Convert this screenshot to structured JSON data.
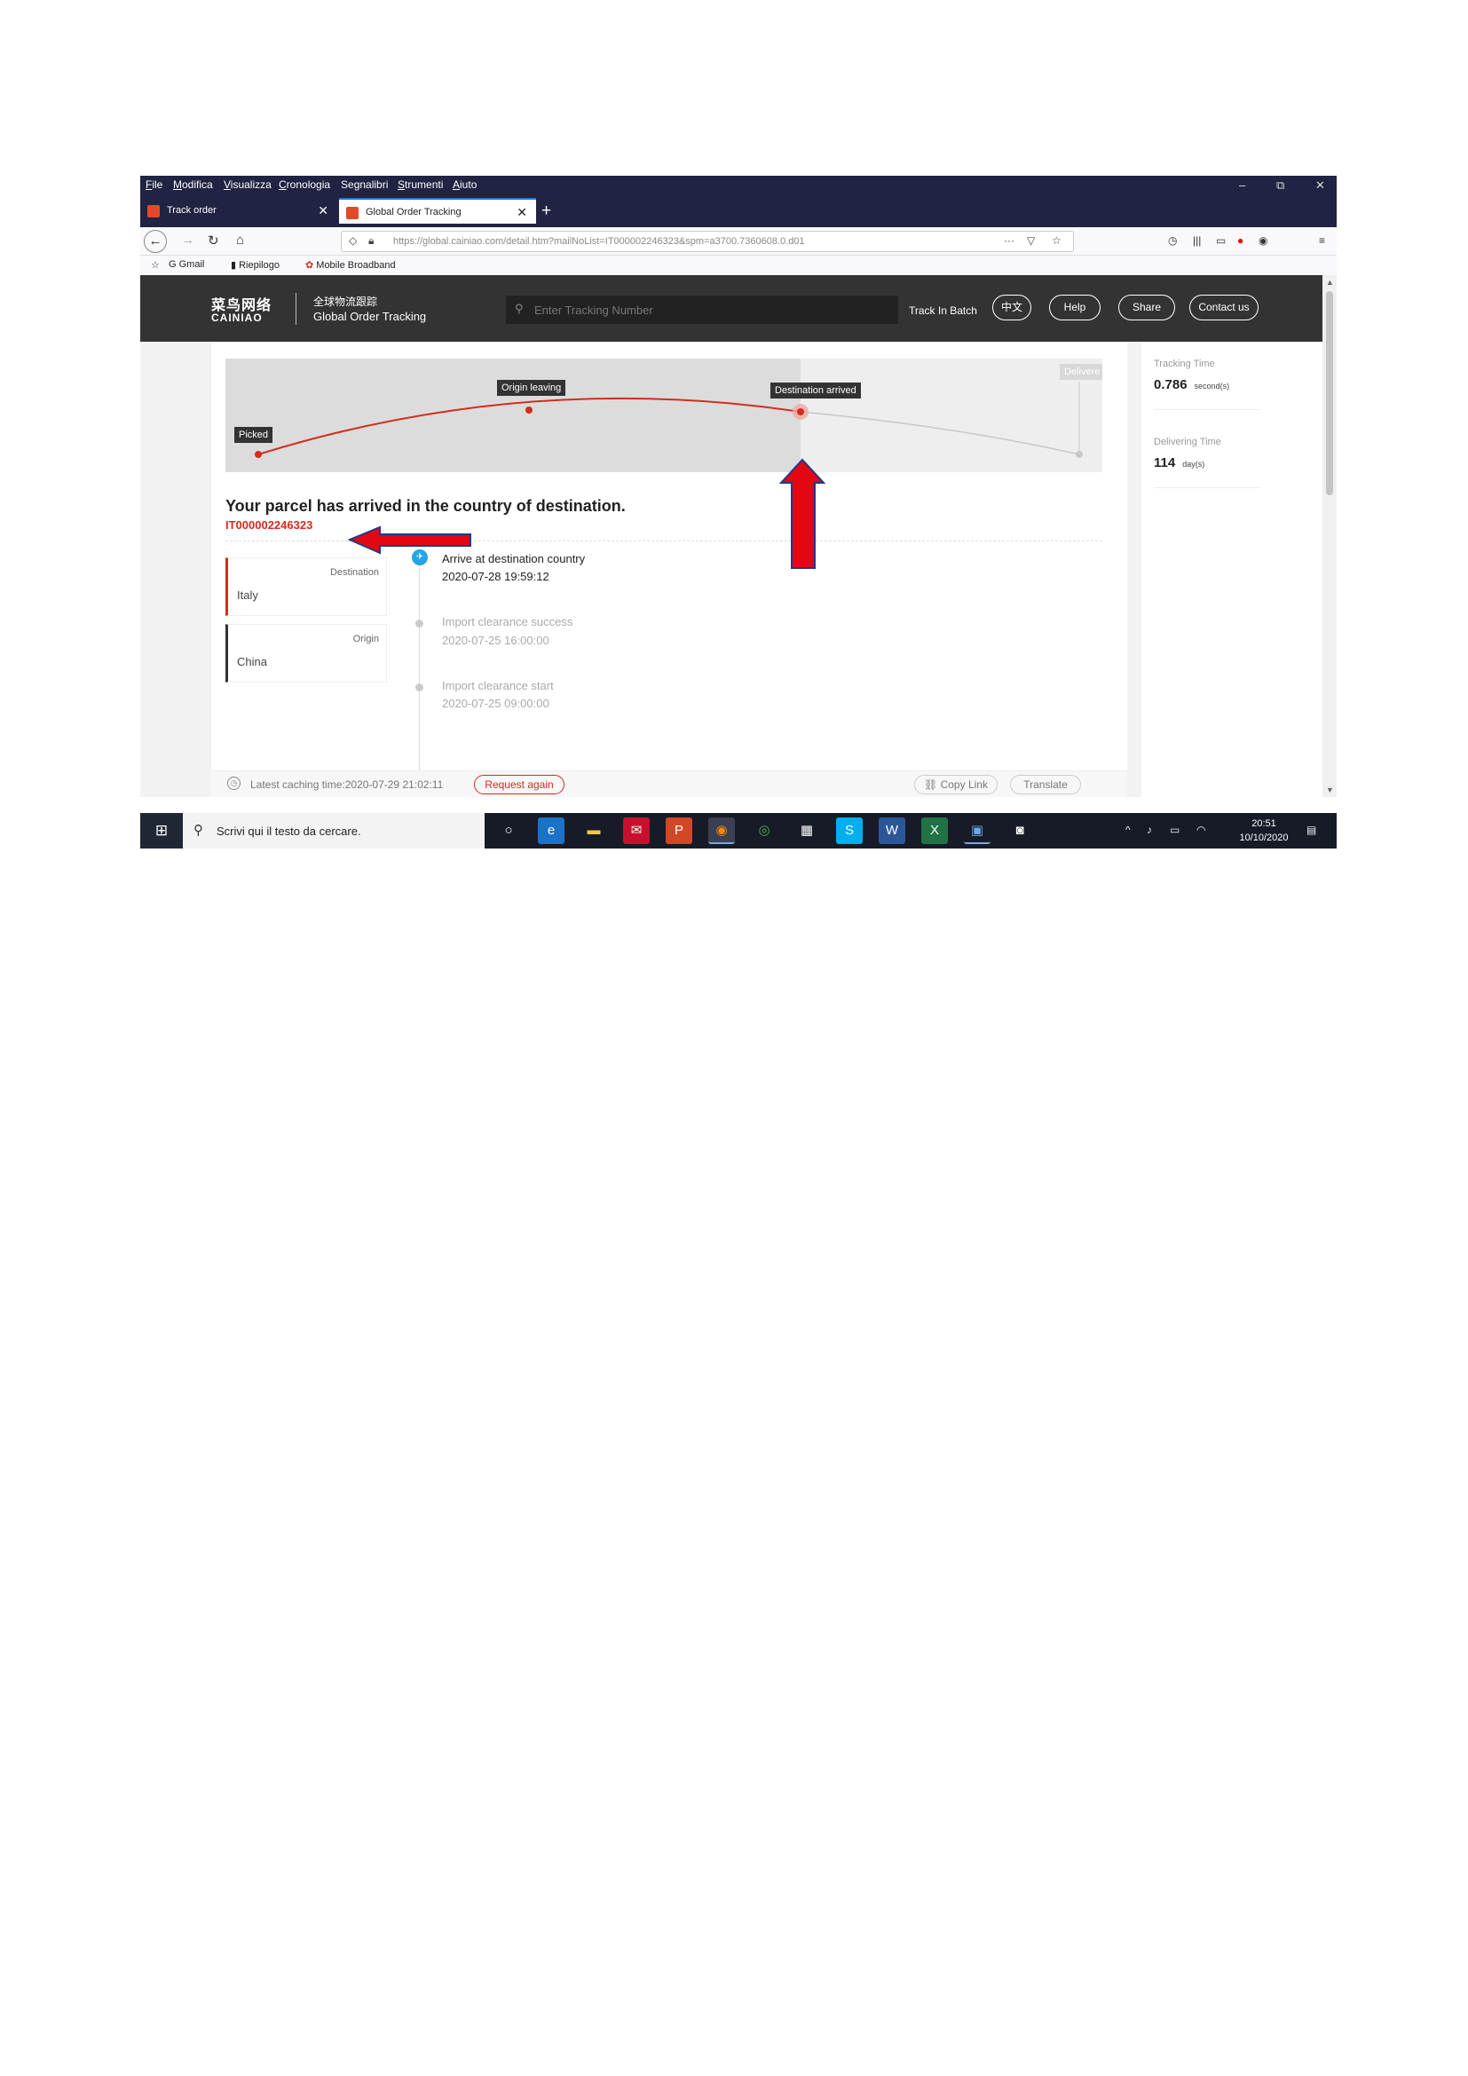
{
  "menu": [
    "File",
    "Modifica",
    "Visualizza",
    "Cronologia",
    "Segnalibri",
    "Strumenti",
    "Aiuto"
  ],
  "menu_access": [
    "F",
    "M",
    "V",
    "C",
    "g",
    "S",
    "A"
  ],
  "window_controls": {
    "minimize": "–",
    "restore": "⧉",
    "close": "✕"
  },
  "tabs": [
    {
      "title": "Track order",
      "close": "✕"
    },
    {
      "title": "Global Order Tracking",
      "close": "✕"
    }
  ],
  "new_tab": "+",
  "nav": {
    "back": "←",
    "forward": "→",
    "reload": "↻",
    "home": "⌂",
    "url": "https://global.cainiao.com/detail.htm?mailNoList=IT000002246323&spm=a3700.7360608.0.d01",
    "more": "···"
  },
  "bookmarks": [
    "Gmail",
    "Riepilogo",
    "Mobile Broadband"
  ],
  "site": {
    "logo_cn": "菜鸟网络",
    "logo_en": "CAINIAO",
    "tagline_cn": "全球物流跟踪",
    "tagline_en": "Global Order Tracking",
    "search_placeholder": "Enter Tracking Number",
    "track_batch": "Track In Batch",
    "lang": "中文",
    "help": "Help",
    "share": "Share",
    "contact": "Contact us"
  },
  "route": {
    "picked": "Picked",
    "origin_leaving": "Origin leaving",
    "destination_arrived": "Destination arrived",
    "delivered": "Delivere"
  },
  "parcel": {
    "status": "Your parcel has arrived in the country of destination.",
    "tracking_number": "IT000002246323"
  },
  "locations": {
    "destination_label": "Destination",
    "destination": "Italy",
    "origin_label": "Origin",
    "origin": "China"
  },
  "events": [
    {
      "title": "Arrive at destination country",
      "time": "2020-07-28 19:59:12"
    },
    {
      "title": "Import clearance success",
      "time": "2020-07-25 16:00:00"
    },
    {
      "title": "Import clearance start",
      "time": "2020-07-25 09:00:00"
    }
  ],
  "stats": {
    "tracking_label": "Tracking Time",
    "tracking_value": "0.786",
    "tracking_unit": "second(s)",
    "delivering_label": "Delivering Time",
    "delivering_value": "114",
    "delivering_unit": "day(s)"
  },
  "footer": {
    "caching": "Latest caching time:2020-07-29 21:02:11",
    "request": "Request again",
    "copy": "Copy Link",
    "translate": "Translate"
  },
  "taskbar": {
    "search": "Scrivi qui il testo da cercare.",
    "time": "20:51",
    "date": "10/10/2020"
  },
  "colors": {
    "accent": "#d52b1e",
    "header": "#333333",
    "titlebar": "#202341"
  }
}
